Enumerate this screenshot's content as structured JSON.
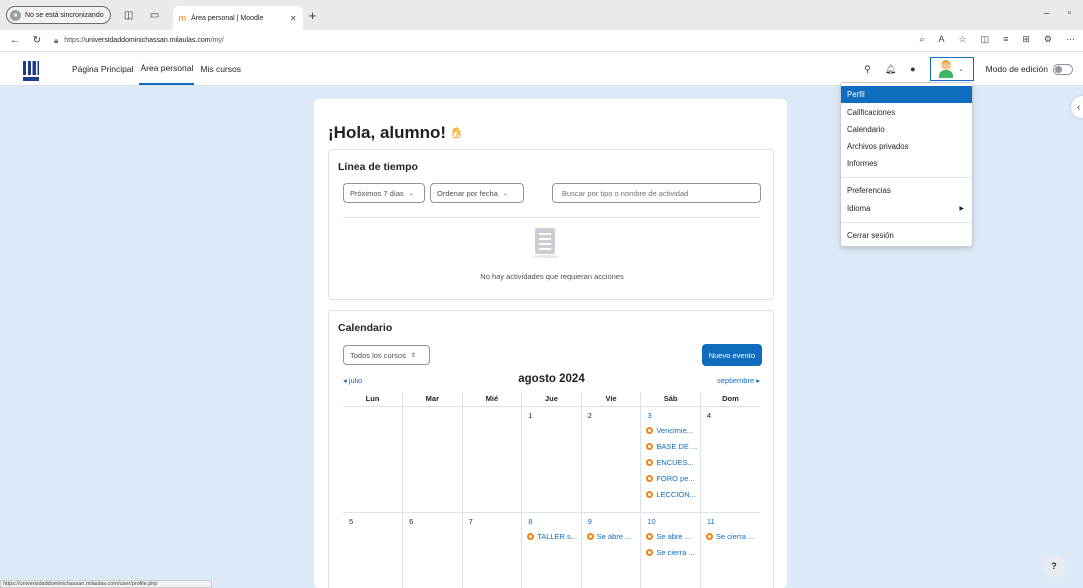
{
  "browser": {
    "sync_label": "No se está sincronizando",
    "tab_title": "Área personal | Moodle",
    "url_prefix": "https://",
    "url_host": "universidaddominichassan.milaulas.com",
    "url_path": "/my/",
    "status_url": "https://universidaddominichassan.milaulas.com/user/profile.php"
  },
  "navbar": {
    "items": [
      "Página Principal",
      "Área personal",
      "Mis cursos"
    ],
    "active": "Área personal",
    "edit_mode_label": "Modo de edición"
  },
  "user_menu": {
    "items": [
      "Perfil",
      "Calificaciones",
      "Calendario",
      "Archivos privados",
      "Informes",
      "Preferencias",
      "Idioma",
      "Cerrar sesión"
    ],
    "highlighted": "Perfil"
  },
  "page": {
    "greeting": "¡Hola, alumno!"
  },
  "timeline": {
    "title": "Línea de tiempo",
    "filter_range": "Próximos 7 días",
    "sort": "Ordenar por fecha",
    "search_placeholder": "Buscar por tipo o nombre de actividad",
    "empty_message": "No hay actividades que requieran acciones"
  },
  "calendar": {
    "title": "Calendario",
    "course_filter": "Todos los cursos",
    "new_event": "Nuevo evento",
    "prev_month": "julio",
    "current_month": "agosto 2024",
    "next_month": "septiembre",
    "weekdays": [
      "Lun",
      "Mar",
      "Mié",
      "Jue",
      "Vie",
      "Sáb",
      "Dom"
    ],
    "week1": {
      "d4": "1",
      "d5": "2",
      "d6": "3",
      "d7": "4",
      "sat_events": [
        "Vencimie...",
        "BASE DE ...",
        "ENCUES...",
        "FORO pe...",
        "LECCIÓN..."
      ]
    },
    "week2": {
      "d1": "5",
      "d2": "6",
      "d3": "7",
      "d4": "8",
      "d5": "9",
      "d6": "10",
      "d7": "11",
      "thu_events": [
        "TALLER s..."
      ],
      "fri_events": [
        "Se abre ..."
      ],
      "sat_events": [
        "Se abre ...",
        "Se cierra ..."
      ],
      "sun_events": [
        "Se cierra ..."
      ]
    }
  },
  "help_label": "?",
  "colors": {
    "primary": "#0f6cbf",
    "event_dot": "#f98012",
    "page_bg": "#dde9f7"
  }
}
